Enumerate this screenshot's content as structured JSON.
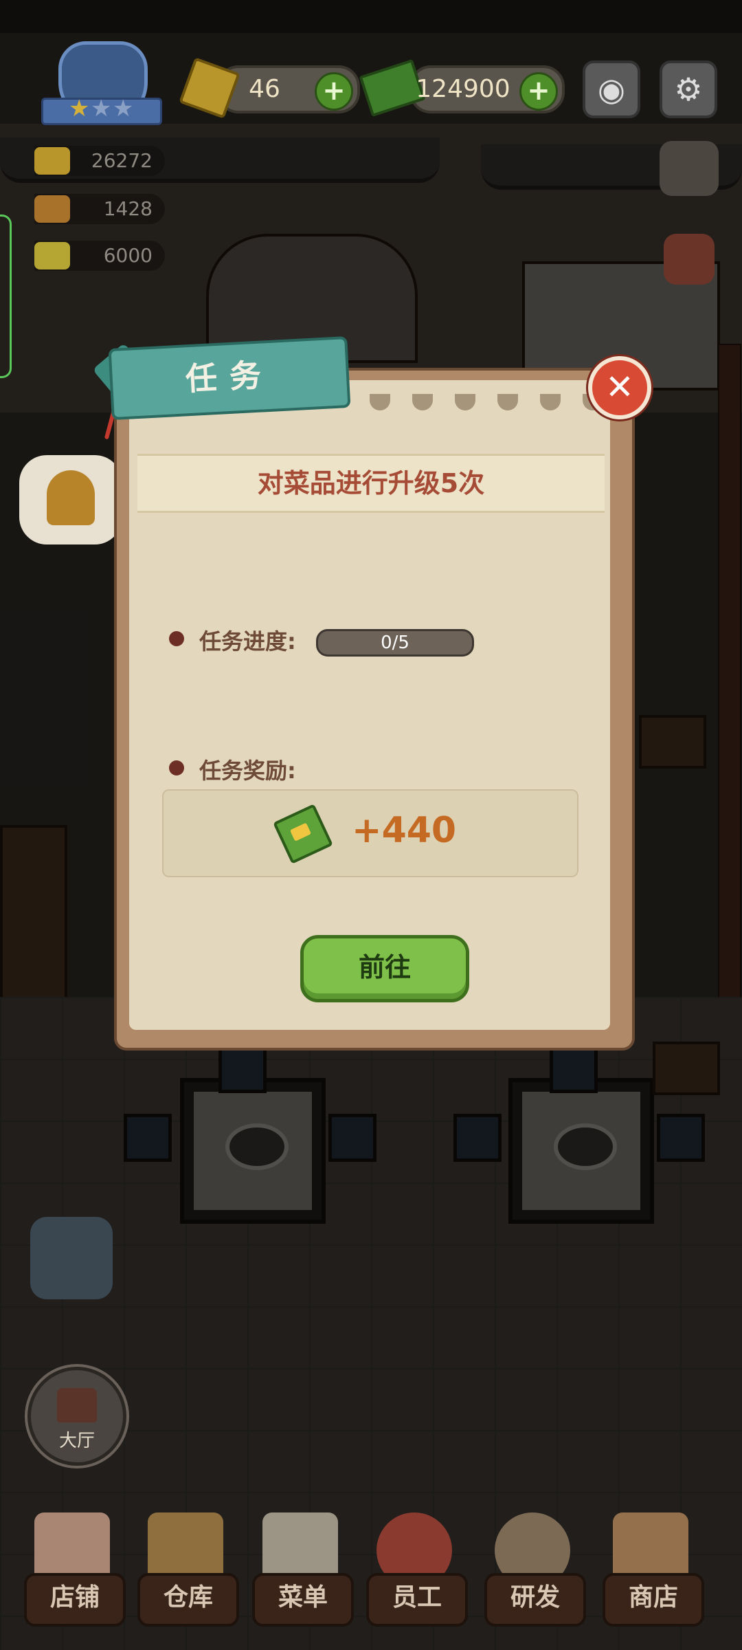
{
  "hud": {
    "gems": "46",
    "cash": "124900",
    "stats": [
      "26272",
      "1428",
      "6000"
    ]
  },
  "hall_label": "大厅",
  "nav": [
    "店铺",
    "仓库",
    "菜单",
    "员工",
    "研发",
    "商店"
  ],
  "dialog": {
    "title": "任务",
    "task_text": "对菜品进行升级5次",
    "progress_label": "任务进度:",
    "progress_value": "0/5",
    "progress_fraction": 0,
    "reward_label": "任务奖励:",
    "reward_value": "+440",
    "go_button": "前往",
    "close_symbol": "✕"
  },
  "colors": {
    "accent_teal": "#58a69b",
    "close_red": "#d94a34",
    "go_green": "#7fc04a",
    "reward_orange": "#c56a23"
  },
  "icons": [
    "level-badge-icon",
    "gem-icon",
    "cash-icon",
    "camera-icon",
    "gear-icon",
    "book-icon",
    "bell-icon",
    "clipboard-icon",
    "hall-icon"
  ]
}
